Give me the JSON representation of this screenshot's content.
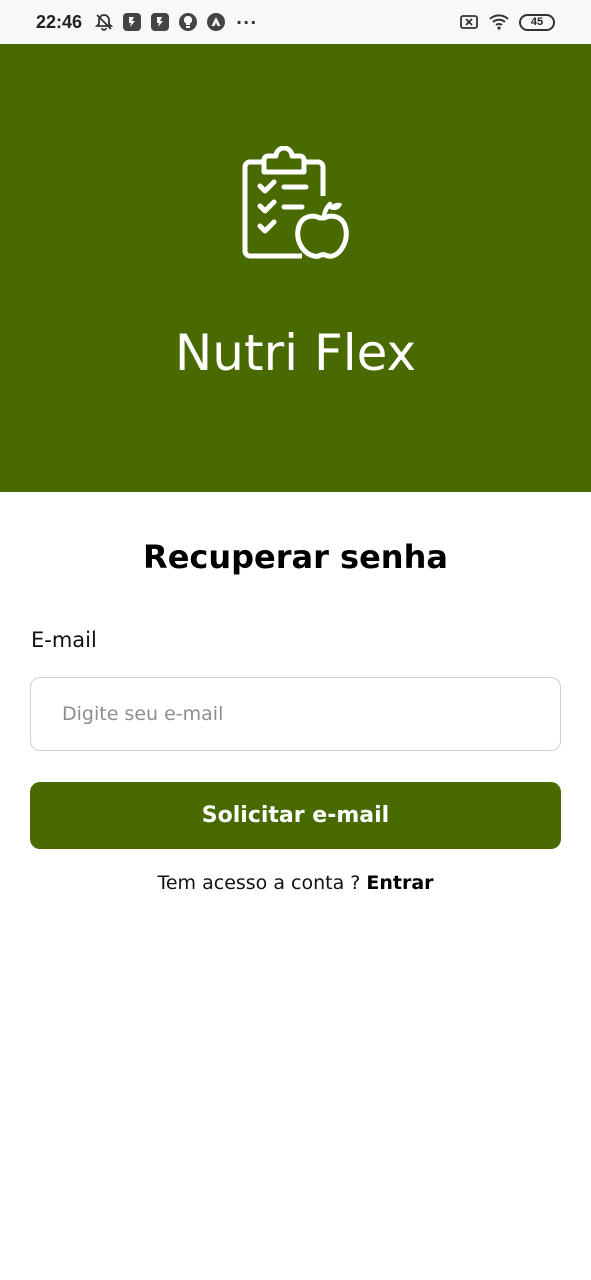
{
  "status_bar": {
    "time": "22:46",
    "icons_left": [
      "notifications-off-icon",
      "app-icon",
      "app-icon",
      "lightbulb-icon",
      "triangle-app-icon"
    ],
    "more_indicator": "···",
    "icons_right": [
      "sim-off-icon",
      "wifi-icon"
    ],
    "battery_level": "45"
  },
  "header": {
    "logo_icon": "clipboard-checklist-apple-icon",
    "app_name": "Nutri Flex",
    "background_color": "#486a00"
  },
  "form": {
    "title": "Recuperar senha",
    "email_label": "E-mail",
    "email_placeholder": "Digite seu e-mail",
    "email_value": "",
    "submit_label": "Solicitar e-mail"
  },
  "footer": {
    "prompt": "Tem acesso a conta ?",
    "login_link": "Entrar"
  },
  "colors": {
    "primary": "#486a00",
    "input_border": "#cfcfcf",
    "placeholder": "#8e8e8e"
  }
}
